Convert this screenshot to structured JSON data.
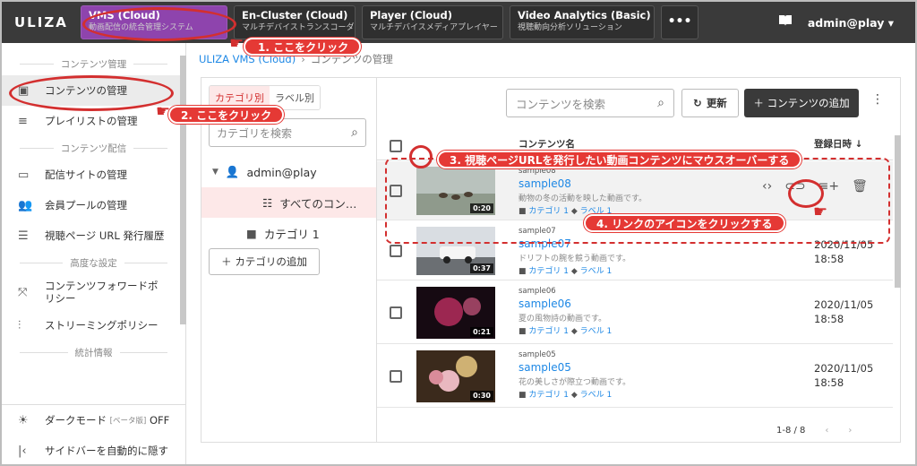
{
  "app": {
    "logo": "ULIZA"
  },
  "topbar": {
    "tabs": [
      {
        "title": "VMS (Cloud)",
        "subtitle": "動画配信の統合管理システム"
      },
      {
        "title": "En-Cluster (Cloud)",
        "subtitle": "マルチデバイストランスコーダー"
      },
      {
        "title": "Player (Cloud)",
        "subtitle": "マルチデバイスメディアプレイヤー"
      },
      {
        "title": "Video Analytics (Basic)",
        "subtitle": "視聴動向分析ソリューション"
      }
    ],
    "more": "•••",
    "user": "admin@play"
  },
  "sidebar": {
    "sections": [
      "コンテンツ管理",
      "コンテンツ配信",
      "高度な設定",
      "統計情報"
    ],
    "items": [
      {
        "label": "コンテンツの管理"
      },
      {
        "label": "プレイリストの管理"
      },
      {
        "label": "配信サイトの管理"
      },
      {
        "label": "会員プールの管理"
      },
      {
        "label": "視聴ページ URL 発行履歴"
      },
      {
        "label": "コンテンツフォワードポ"
      },
      {
        "label": "リシー"
      },
      {
        "label": "ストリーミングポリシー"
      }
    ],
    "dark_mode": {
      "label": "ダークモード",
      "tag": "[ベータ版]",
      "state": "OFF"
    },
    "auto_hide": "サイドバーを自動的に隠す"
  },
  "breadcrumb": {
    "root": "ULIZA VMS (Cloud)",
    "sep": "›",
    "current": "コンテンツの管理"
  },
  "categories": {
    "tabs": [
      "カテゴリ別",
      "ラベル別"
    ],
    "search_placeholder": "カテゴリを検索",
    "root": "admin@play",
    "all": "すべてのコン…",
    "cat1": "カテゴリ 1",
    "add": "＋ カテゴリの追加"
  },
  "toolbar": {
    "search_placeholder": "コンテンツを検索",
    "refresh": "更新",
    "add": "＋ コンテンツの追加"
  },
  "table": {
    "col_name": "コンテンツ名",
    "col_date": "登録日時 ↓",
    "rows": [
      {
        "id": "sample08",
        "title": "sample08",
        "desc": "動物の冬の活動を映した動画です。",
        "cat": "カテゴリ 1",
        "label": "ラベル 1",
        "date": "",
        "time": "",
        "dur": "0:20"
      },
      {
        "id": "sample07",
        "title": "sample07",
        "desc": "ドリフトの腕を競う動画です。",
        "cat": "カテゴリ 1",
        "label": "ラベル 1",
        "date": "2020/11/05",
        "time": "18:58",
        "dur": "0:37"
      },
      {
        "id": "sample06",
        "title": "sample06",
        "desc": "夏の風物詩の動画です。",
        "cat": "カテゴリ 1",
        "label": "ラベル 1",
        "date": "2020/11/05",
        "time": "18:58",
        "dur": "0:21"
      },
      {
        "id": "sample05",
        "title": "sample05",
        "desc": "花の美しさが際立つ動画です。",
        "cat": "カテゴリ 1",
        "label": "ラベル 1",
        "date": "2020/11/05",
        "time": "18:58",
        "dur": "0:30"
      }
    ],
    "pager": "1-8 / 8"
  },
  "annotations": {
    "step1": "1. ここをクリック",
    "step2": "2. ここをクリック",
    "step3": "3. 視聴ページURLを発行したい動画コンテンツにマウスオーバーする",
    "step4": "4. リンクのアイコンをクリックする"
  },
  "colors": {
    "accent": "#8e44ad",
    "annotation": "#e53935",
    "link": "#1e88e5"
  }
}
